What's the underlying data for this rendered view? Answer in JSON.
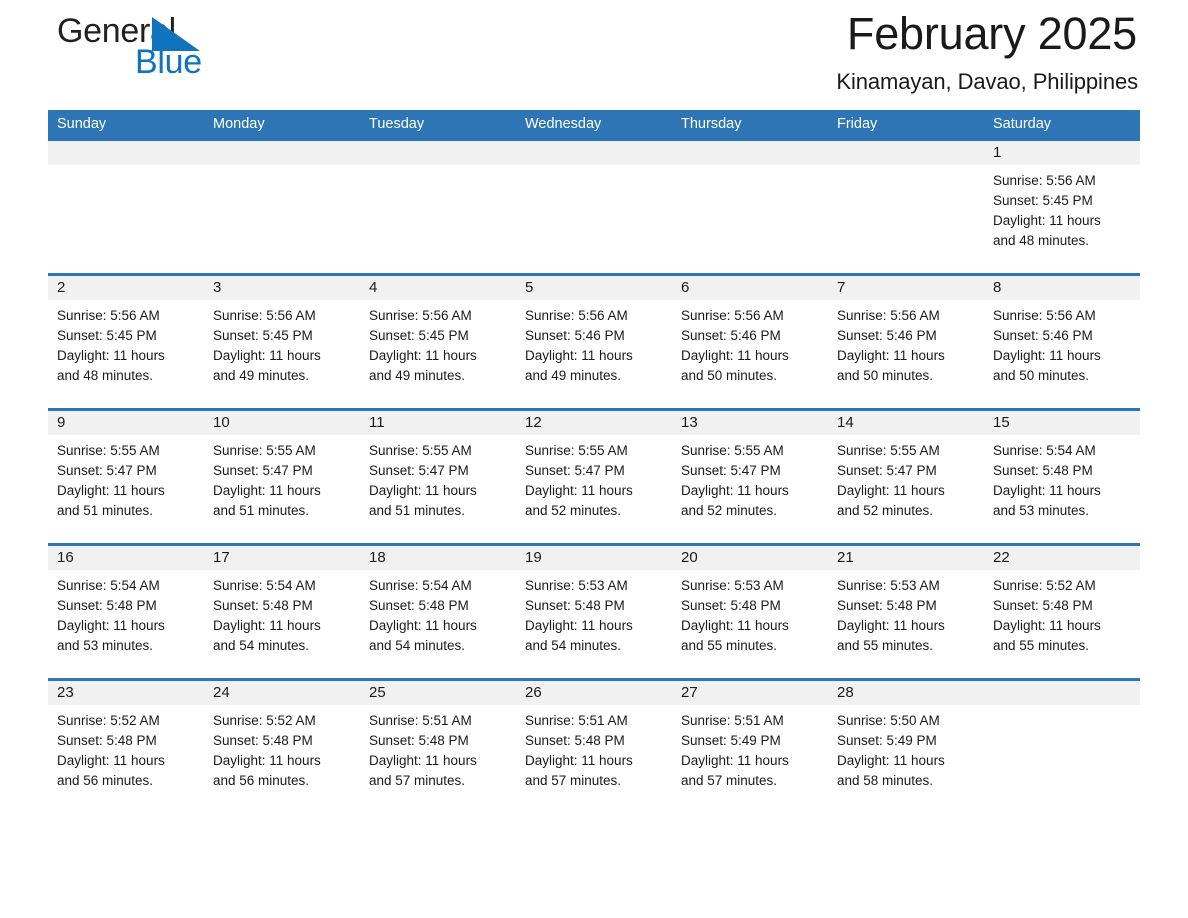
{
  "logo": {
    "word1": "General",
    "word2": "Blue",
    "triangle_color": "#1073bd",
    "word1_color": "#231f20",
    "word2_color": "#1073bd"
  },
  "header": {
    "title": "February 2025",
    "subtitle": "Kinamayan, Davao, Philippines"
  },
  "theme": {
    "header_blue": "#2e75b6",
    "band_gray": "#f1f1f1",
    "text": "#1a1a1a"
  },
  "weekdays": [
    "Sunday",
    "Monday",
    "Tuesday",
    "Wednesday",
    "Thursday",
    "Friday",
    "Saturday"
  ],
  "weeks": [
    [
      {
        "day": "",
        "sunrise": "",
        "sunset": "",
        "daylight_line1": "",
        "daylight_line2": ""
      },
      {
        "day": "",
        "sunrise": "",
        "sunset": "",
        "daylight_line1": "",
        "daylight_line2": ""
      },
      {
        "day": "",
        "sunrise": "",
        "sunset": "",
        "daylight_line1": "",
        "daylight_line2": ""
      },
      {
        "day": "",
        "sunrise": "",
        "sunset": "",
        "daylight_line1": "",
        "daylight_line2": ""
      },
      {
        "day": "",
        "sunrise": "",
        "sunset": "",
        "daylight_line1": "",
        "daylight_line2": ""
      },
      {
        "day": "",
        "sunrise": "",
        "sunset": "",
        "daylight_line1": "",
        "daylight_line2": ""
      },
      {
        "day": "1",
        "sunrise": "Sunrise: 5:56 AM",
        "sunset": "Sunset: 5:45 PM",
        "daylight_line1": "Daylight: 11 hours",
        "daylight_line2": "and 48 minutes."
      }
    ],
    [
      {
        "day": "2",
        "sunrise": "Sunrise: 5:56 AM",
        "sunset": "Sunset: 5:45 PM",
        "daylight_line1": "Daylight: 11 hours",
        "daylight_line2": "and 48 minutes."
      },
      {
        "day": "3",
        "sunrise": "Sunrise: 5:56 AM",
        "sunset": "Sunset: 5:45 PM",
        "daylight_line1": "Daylight: 11 hours",
        "daylight_line2": "and 49 minutes."
      },
      {
        "day": "4",
        "sunrise": "Sunrise: 5:56 AM",
        "sunset": "Sunset: 5:45 PM",
        "daylight_line1": "Daylight: 11 hours",
        "daylight_line2": "and 49 minutes."
      },
      {
        "day": "5",
        "sunrise": "Sunrise: 5:56 AM",
        "sunset": "Sunset: 5:46 PM",
        "daylight_line1": "Daylight: 11 hours",
        "daylight_line2": "and 49 minutes."
      },
      {
        "day": "6",
        "sunrise": "Sunrise: 5:56 AM",
        "sunset": "Sunset: 5:46 PM",
        "daylight_line1": "Daylight: 11 hours",
        "daylight_line2": "and 50 minutes."
      },
      {
        "day": "7",
        "sunrise": "Sunrise: 5:56 AM",
        "sunset": "Sunset: 5:46 PM",
        "daylight_line1": "Daylight: 11 hours",
        "daylight_line2": "and 50 minutes."
      },
      {
        "day": "8",
        "sunrise": "Sunrise: 5:56 AM",
        "sunset": "Sunset: 5:46 PM",
        "daylight_line1": "Daylight: 11 hours",
        "daylight_line2": "and 50 minutes."
      }
    ],
    [
      {
        "day": "9",
        "sunrise": "Sunrise: 5:55 AM",
        "sunset": "Sunset: 5:47 PM",
        "daylight_line1": "Daylight: 11 hours",
        "daylight_line2": "and 51 minutes."
      },
      {
        "day": "10",
        "sunrise": "Sunrise: 5:55 AM",
        "sunset": "Sunset: 5:47 PM",
        "daylight_line1": "Daylight: 11 hours",
        "daylight_line2": "and 51 minutes."
      },
      {
        "day": "11",
        "sunrise": "Sunrise: 5:55 AM",
        "sunset": "Sunset: 5:47 PM",
        "daylight_line1": "Daylight: 11 hours",
        "daylight_line2": "and 51 minutes."
      },
      {
        "day": "12",
        "sunrise": "Sunrise: 5:55 AM",
        "sunset": "Sunset: 5:47 PM",
        "daylight_line1": "Daylight: 11 hours",
        "daylight_line2": "and 52 minutes."
      },
      {
        "day": "13",
        "sunrise": "Sunrise: 5:55 AM",
        "sunset": "Sunset: 5:47 PM",
        "daylight_line1": "Daylight: 11 hours",
        "daylight_line2": "and 52 minutes."
      },
      {
        "day": "14",
        "sunrise": "Sunrise: 5:55 AM",
        "sunset": "Sunset: 5:47 PM",
        "daylight_line1": "Daylight: 11 hours",
        "daylight_line2": "and 52 minutes."
      },
      {
        "day": "15",
        "sunrise": "Sunrise: 5:54 AM",
        "sunset": "Sunset: 5:48 PM",
        "daylight_line1": "Daylight: 11 hours",
        "daylight_line2": "and 53 minutes."
      }
    ],
    [
      {
        "day": "16",
        "sunrise": "Sunrise: 5:54 AM",
        "sunset": "Sunset: 5:48 PM",
        "daylight_line1": "Daylight: 11 hours",
        "daylight_line2": "and 53 minutes."
      },
      {
        "day": "17",
        "sunrise": "Sunrise: 5:54 AM",
        "sunset": "Sunset: 5:48 PM",
        "daylight_line1": "Daylight: 11 hours",
        "daylight_line2": "and 54 minutes."
      },
      {
        "day": "18",
        "sunrise": "Sunrise: 5:54 AM",
        "sunset": "Sunset: 5:48 PM",
        "daylight_line1": "Daylight: 11 hours",
        "daylight_line2": "and 54 minutes."
      },
      {
        "day": "19",
        "sunrise": "Sunrise: 5:53 AM",
        "sunset": "Sunset: 5:48 PM",
        "daylight_line1": "Daylight: 11 hours",
        "daylight_line2": "and 54 minutes."
      },
      {
        "day": "20",
        "sunrise": "Sunrise: 5:53 AM",
        "sunset": "Sunset: 5:48 PM",
        "daylight_line1": "Daylight: 11 hours",
        "daylight_line2": "and 55 minutes."
      },
      {
        "day": "21",
        "sunrise": "Sunrise: 5:53 AM",
        "sunset": "Sunset: 5:48 PM",
        "daylight_line1": "Daylight: 11 hours",
        "daylight_line2": "and 55 minutes."
      },
      {
        "day": "22",
        "sunrise": "Sunrise: 5:52 AM",
        "sunset": "Sunset: 5:48 PM",
        "daylight_line1": "Daylight: 11 hours",
        "daylight_line2": "and 55 minutes."
      }
    ],
    [
      {
        "day": "23",
        "sunrise": "Sunrise: 5:52 AM",
        "sunset": "Sunset: 5:48 PM",
        "daylight_line1": "Daylight: 11 hours",
        "daylight_line2": "and 56 minutes."
      },
      {
        "day": "24",
        "sunrise": "Sunrise: 5:52 AM",
        "sunset": "Sunset: 5:48 PM",
        "daylight_line1": "Daylight: 11 hours",
        "daylight_line2": "and 56 minutes."
      },
      {
        "day": "25",
        "sunrise": "Sunrise: 5:51 AM",
        "sunset": "Sunset: 5:48 PM",
        "daylight_line1": "Daylight: 11 hours",
        "daylight_line2": "and 57 minutes."
      },
      {
        "day": "26",
        "sunrise": "Sunrise: 5:51 AM",
        "sunset": "Sunset: 5:48 PM",
        "daylight_line1": "Daylight: 11 hours",
        "daylight_line2": "and 57 minutes."
      },
      {
        "day": "27",
        "sunrise": "Sunrise: 5:51 AM",
        "sunset": "Sunset: 5:49 PM",
        "daylight_line1": "Daylight: 11 hours",
        "daylight_line2": "and 57 minutes."
      },
      {
        "day": "28",
        "sunrise": "Sunrise: 5:50 AM",
        "sunset": "Sunset: 5:49 PM",
        "daylight_line1": "Daylight: 11 hours",
        "daylight_line2": "and 58 minutes."
      },
      {
        "day": "",
        "sunrise": "",
        "sunset": "",
        "daylight_line1": "",
        "daylight_line2": ""
      }
    ]
  ]
}
